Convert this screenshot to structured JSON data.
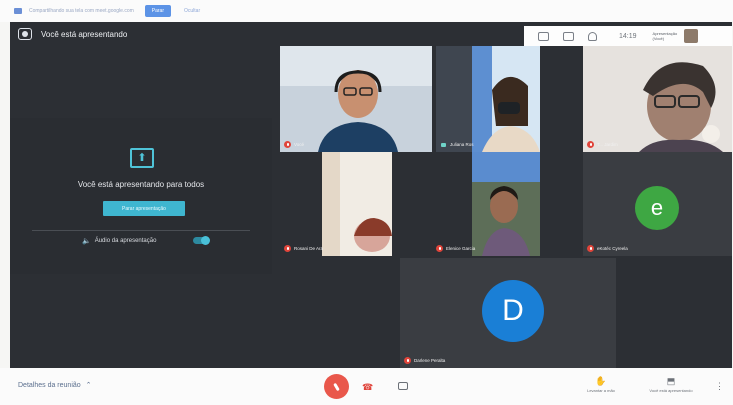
{
  "share_banner": {
    "text": "Compartilhando sua tela com meet.google.com",
    "stop_label": "Parar",
    "hide_label": "Ocultar"
  },
  "meeting": {
    "presenting_title": "Você está apresentando",
    "clock": "14:19",
    "self_thumb_label": "Apresentação (Você)"
  },
  "presenting_panel": {
    "message": "Você está apresentando para todos",
    "stop_button": "Parar apresentação",
    "audio_label": "Áudio da apresentação"
  },
  "participants": [
    {
      "name": "Vocé",
      "muted": true
    },
    {
      "name": "Juliana Ros",
      "muted": false
    },
    {
      "name": "T... Jardim",
      "muted": true
    },
    {
      "name": "Rosani De Ara",
      "muted": true
    },
    {
      "name": "Elenice Garcia",
      "muted": true
    },
    {
      "name": "eKotéc Cyreela",
      "muted": true,
      "avatar_letter": "e",
      "avatar_color": "#3ea743"
    },
    {
      "name": "Darlene Peralta",
      "muted": true,
      "avatar_letter": "D",
      "avatar_color": "#1a7fd6"
    }
  ],
  "bottom_bar": {
    "details_label": "Detalhes da reunião",
    "raise_hand_label": "Levantar a mão",
    "presenting_label": "Você está apresentando"
  },
  "colors": {
    "accent": "#3fb6d0",
    "mic_off": "#e0443a",
    "meeting_bg": "#2c2f34"
  }
}
